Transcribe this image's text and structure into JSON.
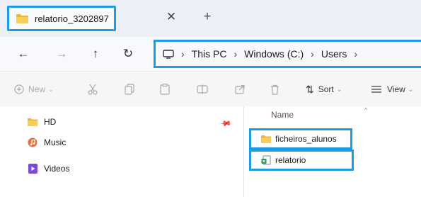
{
  "tab": {
    "title": "relatorio_3202897",
    "close_label": "✕",
    "new_label": "+"
  },
  "nav": {
    "back": "←",
    "forward": "→",
    "up": "↑",
    "refresh": "↻"
  },
  "breadcrumb": {
    "separator": "›",
    "items": [
      "This PC",
      "Windows (C:)",
      "Users"
    ]
  },
  "toolbar": {
    "new_label": "New",
    "sort_label": "Sort",
    "view_label": "View"
  },
  "quick_access": [
    {
      "label": "HD",
      "icon": "folder-icon"
    },
    {
      "label": "Music",
      "icon": "music-icon"
    },
    {
      "label": "Videos",
      "icon": "video-icon"
    }
  ],
  "file_list": {
    "column_name": "Name",
    "items": [
      {
        "name": "ficheiros_alunos",
        "icon": "folder-icon"
      },
      {
        "name": "relatorio",
        "icon": "file-icon"
      }
    ]
  },
  "colors": {
    "highlight": "#1f9be6",
    "folder": "#f5c34a"
  }
}
